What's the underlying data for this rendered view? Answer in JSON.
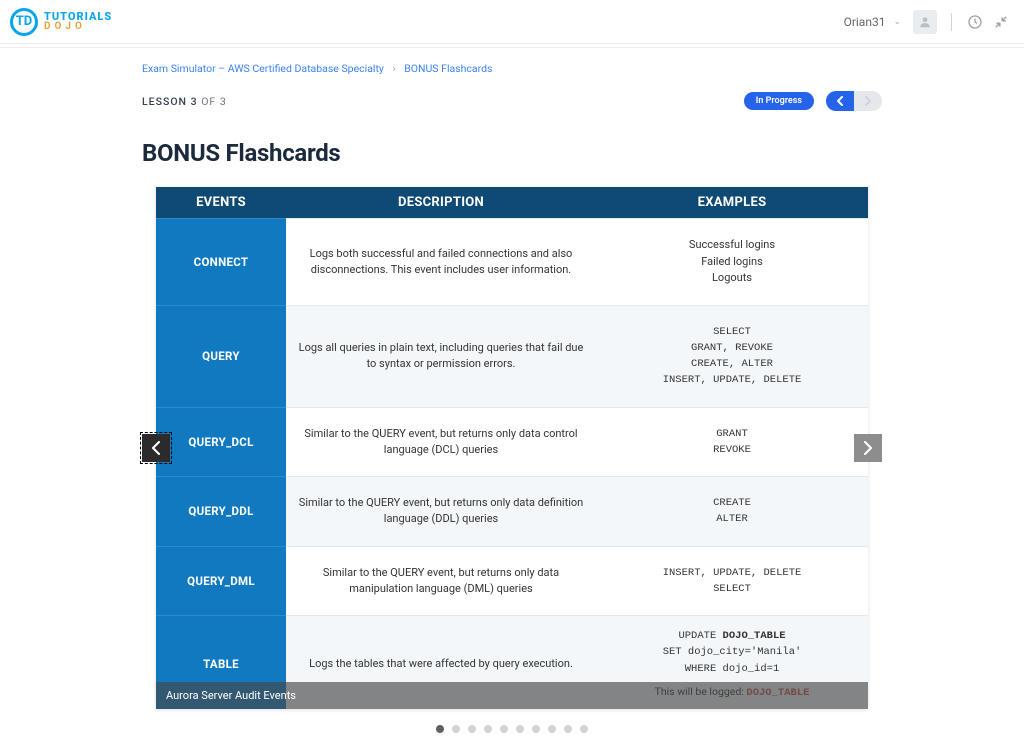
{
  "logo": {
    "badge": "TD",
    "top": "TUTORIALS",
    "bottom": "DOJO"
  },
  "user": {
    "name": "Orian31"
  },
  "breadcrumb": {
    "item1": "Exam Simulator – AWS Certified Database Specialty",
    "sep": "›",
    "item2": "BONUS Flashcards"
  },
  "lesson": {
    "label_a": "LESSON",
    "num": "3",
    "label_b": "OF 3",
    "status": "In Progress"
  },
  "page_title": "BONUS Flashcards",
  "table": {
    "head": {
      "events": "EVENTS",
      "description": "DESCRIPTION",
      "examples": "EXAMPLES"
    },
    "rows": [
      {
        "event": "CONNECT",
        "desc": "Logs both successful and failed connections and also disconnections. This event includes user information.",
        "examples_plain": "Successful logins\nFailed logins\nLogouts"
      },
      {
        "event": "QUERY",
        "desc": "Logs all queries in plain text, including queries that fail due to syntax or permission errors.",
        "examples_mono": "SELECT\nGRANT, REVOKE\nCREATE, ALTER\nINSERT, UPDATE, DELETE"
      },
      {
        "event": "QUERY_DCL",
        "desc": "Similar to the QUERY event, but returns only data control language (DCL) queries",
        "examples_mono": "GRANT\nREVOKE"
      },
      {
        "event": "QUERY_DDL",
        "desc": "Similar to the QUERY event, but returns only data definition language (DDL) queries",
        "examples_mono": "CREATE\nALTER"
      },
      {
        "event": "QUERY_DML",
        "desc": "Similar to the QUERY event, but returns only data manipulation language (DML) queries",
        "examples_mono": "INSERT, UPDATE, DELETE\nSELECT"
      },
      {
        "event": "TABLE",
        "desc": "Logs the tables that were affected by query execution.",
        "examples_mono_html": "UPDATE <b>DOJO_TABLE</b>\nSET dojo_city='Manila'\nWHERE dojo_id=1",
        "logged_note_pre": "This will be logged: ",
        "logged_note_hl": "DOJO_TABLE"
      }
    ]
  },
  "caption": "Aurora Server Audit Events",
  "dots": {
    "count": 10,
    "active": 0
  }
}
